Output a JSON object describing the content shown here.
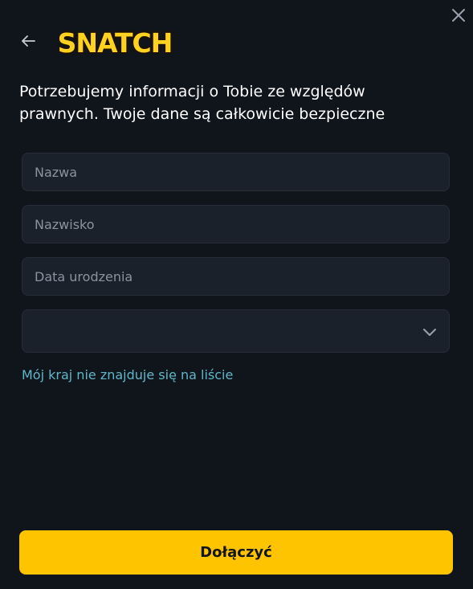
{
  "header": {
    "close_icon": "close-icon",
    "back_icon": "arrow-left-icon",
    "logo_text": "SNATCH"
  },
  "intro_text": "Potrzebujemy informacji o Tobie ze względów prawnych. Twoje dane są całkowicie bezpieczne",
  "form": {
    "first_name": {
      "placeholder": "Nazwa",
      "value": ""
    },
    "last_name": {
      "placeholder": "Nazwisko",
      "value": ""
    },
    "birth_date": {
      "placeholder": "Data urodzenia",
      "value": ""
    },
    "country": {
      "value": "",
      "icon": "chevron-down-icon"
    },
    "country_missing_link": "Mój kraj nie znajduje się na liście",
    "submit_label": "Dołączyć"
  },
  "colors": {
    "background": "#10141b",
    "field_bg": "#1b212b",
    "accent": "#ffc400",
    "link": "#5fb7c8"
  }
}
